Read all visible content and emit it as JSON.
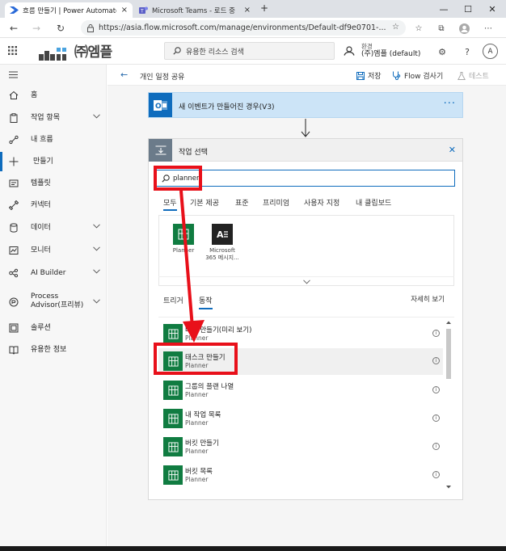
{
  "browser": {
    "tabs": [
      {
        "title": "흐름 만들기 | Power Automate",
        "active": true
      },
      {
        "title": "Microsoft Teams - 로드 중",
        "active": false
      }
    ],
    "new_tab": "+",
    "window_controls": [
      "—",
      "☐",
      "✕"
    ],
    "url": "https://asia.flow.microsoft.com/manage/environments/Default-df9e0701-..."
  },
  "header": {
    "logo_text": "㈜엠플",
    "search_placeholder": "유용한 리소스 검색",
    "env_label": "환경",
    "env_value": "(주)엠플 (default)",
    "avatar_initial": "A"
  },
  "sidebar": {
    "items": [
      {
        "label": "홈",
        "icon": "home-icon",
        "chevron": false,
        "active": false
      },
      {
        "label": "작업 항목",
        "icon": "clipboard-icon",
        "chevron": true,
        "active": false
      },
      {
        "label": "내 흐름",
        "icon": "flow-icon",
        "chevron": false,
        "active": false
      },
      {
        "label": "만들기",
        "icon": "plus-icon",
        "chevron": false,
        "active": true
      },
      {
        "label": "템플릿",
        "icon": "template-icon",
        "chevron": false,
        "active": false
      },
      {
        "label": "커넥터",
        "icon": "connector-icon",
        "chevron": false,
        "active": false
      },
      {
        "label": "데이터",
        "icon": "database-icon",
        "chevron": true,
        "active": false
      },
      {
        "label": "모니터",
        "icon": "monitor-icon",
        "chevron": true,
        "active": false
      },
      {
        "label": "AI Builder",
        "icon": "ai-builder-icon",
        "chevron": true,
        "active": false
      },
      {
        "label": "Process Advisor(프리뷰)",
        "line1": "Process",
        "line2": "Advisor(프리뷰)",
        "icon": "process-advisor-icon",
        "chevron": true,
        "active": false
      },
      {
        "label": "솔루션",
        "icon": "solution-icon",
        "chevron": false,
        "active": false
      },
      {
        "label": "유용한 정보",
        "icon": "book-icon",
        "chevron": false,
        "active": false
      }
    ]
  },
  "commandbar": {
    "flow_name": "개인 일정 공유",
    "save": "저장",
    "flow_checker": "Flow 검사기",
    "test": "테스트"
  },
  "trigger": {
    "title": "새 이벤트가 만들어진 경우(V3)",
    "more": "···"
  },
  "panel": {
    "title": "작업 선택",
    "search_value": "planner",
    "tabs": [
      "모두",
      "기본 제공",
      "표준",
      "프리미엄",
      "사용자 지정",
      "내 클립보드"
    ],
    "active_tab": "모두",
    "connectors": [
      {
        "name": "Planner",
        "color": "#107c41"
      },
      {
        "name": "Microsoft 365 메시지...",
        "line1": "Microsoft",
        "line2": "365 메시지...",
        "color": "#222222"
      }
    ],
    "subtabs": {
      "triggers": "트리거",
      "actions": "동작",
      "active": "동작"
    },
    "see_more": "자세히 보기",
    "actions": [
      {
        "name": "버킷 만들기(미리 보기)",
        "connector": "Planner",
        "highlighted": false
      },
      {
        "name": "태스크 만들기",
        "connector": "Planner",
        "highlighted": true
      },
      {
        "name": "그룹의 플랜 나열",
        "connector": "Planner",
        "highlighted": false
      },
      {
        "name": "내 작업 목록",
        "connector": "Planner",
        "highlighted": false
      },
      {
        "name": "버킷 만들기",
        "connector": "Planner",
        "highlighted": false
      },
      {
        "name": "버킷 목록",
        "connector": "Planner",
        "highlighted": false
      }
    ]
  },
  "colors": {
    "accent": "#0f6cbd",
    "planner": "#107c41",
    "annotation": "#e8101a",
    "trigger_bg": "#cce4f7"
  }
}
